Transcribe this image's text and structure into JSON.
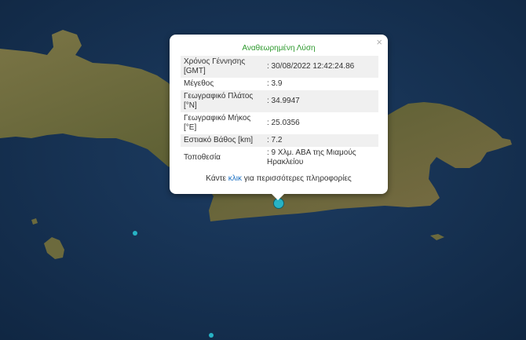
{
  "popup": {
    "title": "Αναθεωρημένη Λύση",
    "close": "×",
    "rows": [
      {
        "label": "Χρόνος Γέννησης [GMT]",
        "value": ": 30/08/2022 12:42:24.86"
      },
      {
        "label": "Μέγεθος",
        "value": ": 3.9"
      },
      {
        "label": "Γεωγραφικό Πλάτος [°N]",
        "value": ": 34.9947"
      },
      {
        "label": "Γεωγραφικό Μήκος [°E]",
        "value": ": 25.0356"
      },
      {
        "label": "Εστιακό Βάθος [km]",
        "value": ": 7.2"
      },
      {
        "label": "Τοποθεσία",
        "value": ": 9 Χλμ. ΑΒΑ της Μιαμούς Ηρακλείου"
      }
    ],
    "footer_pre": "Κάντε ",
    "footer_link": "κλικ",
    "footer_post": " για περισσότερες πληροφορίες"
  },
  "colors": {
    "sea": "#16304f",
    "land": "#6e6a3e",
    "marker": "#27b3c5"
  }
}
